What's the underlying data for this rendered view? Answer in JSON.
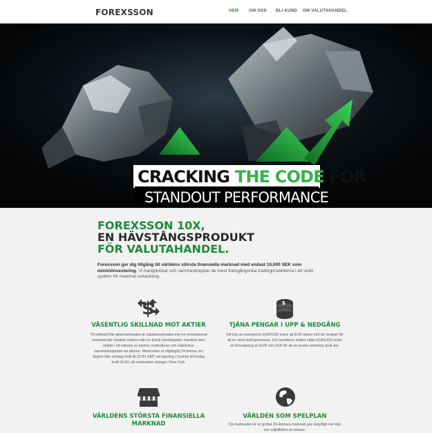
{
  "brand": {
    "logo": "FOREXSSON"
  },
  "nav": {
    "items": [
      {
        "label": "HEM",
        "active": true
      },
      {
        "label": "OM OSS",
        "active": false
      },
      {
        "label": "BLI KUND",
        "active": false
      },
      {
        "label": "OM VALUTAHANDEL",
        "active": false
      }
    ]
  },
  "hero": {
    "line1_a": "CRACKING ",
    "line1_b": "THE CODE",
    "line1_c": " FOR",
    "line2": "STANDOUT PERFORMANCE"
  },
  "product": {
    "title_l1": "FOREXSSON 10X,",
    "title_l2": "EN HÄVSTÅNGSPRODUKT",
    "title_l3": "FÖR VALUTAHANDEL.",
    "intro_bold": "Forexsson ger dig tillgång till världens största finansiella marknad med endast 10,000 SEK som minimiinvestering.",
    "intro_rest": " Vi handplockar och sammankopplar de mest framgångsrika tradingmodellerna i ett unikt system för maximal avkastning."
  },
  "features": [
    {
      "icon": "dollar-exchange-icon",
      "title": "VÄSENTLIG SKILLNAD MOT AKTIER",
      "body": "Till skillnad från aktiemarknaden är valutamarknaden inte en centraliserad marknad där handeln bedrivs från en fysisk handelsplats. Handeln sker istället i ett nätverk av banker, institutioner och mäklarhus sammankopplade via datorer. Marknaden är tillgänglig 24 timmar om dygnet från söndag kväll till 22:00 GMT vid öppning i Sydney till fredag kväll 20:00, då marknaden stänger i New York."
    },
    {
      "icon": "coins-icon",
      "title": "TJÄNA PENGAR I UPP & NEDGÅNG",
      "body": "Vid köp av exempelvis EUR/USD krävs att EUR stärks mot sin motpart för att en vinst skall genereras. Om handlaren istället säljer EUR/USD krävs en försvagning av EUR och USD för att en positiv utväxling skall ske."
    },
    {
      "icon": "storefront-icon",
      "title": "VÄRLDENS STÖRSTA FINANSIELLA MARKNAD",
      "body": ""
    },
    {
      "icon": "globe-icon",
      "title": "VÄRLDEN SOM SPELPLAN",
      "body": "Då marknaden är en global 24-timmars marknad ges betydligt mer köp och säljtillfällen än börsen."
    }
  ],
  "colors": {
    "accent": "#1f8a3a",
    "hero_green": "#38b14a",
    "text": "#2a2a2a"
  }
}
